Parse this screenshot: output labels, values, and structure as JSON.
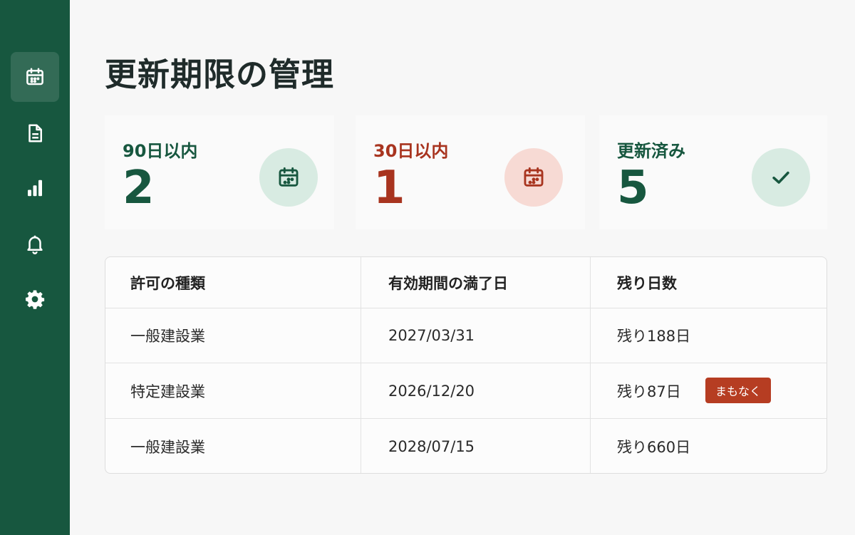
{
  "nav": {
    "items": [
      {
        "icon": "calendar-icon",
        "active": true
      },
      {
        "icon": "document-icon",
        "active": false
      },
      {
        "icon": "bar-chart-icon",
        "active": false
      },
      {
        "icon": "bell-icon",
        "active": false
      },
      {
        "icon": "gear-icon",
        "active": false
      }
    ]
  },
  "page": {
    "title": "更新期限の管理"
  },
  "stats": [
    {
      "label": "90日以内",
      "value": "2",
      "icon": "calendar-icon",
      "color": "#17573f"
    },
    {
      "label": "30日以内",
      "value": "1",
      "icon": "calendar-icon",
      "color": "#a8341f"
    },
    {
      "label": "更新済み",
      "value": "5",
      "icon": "check-icon",
      "color": "#17573f"
    }
  ],
  "table": {
    "headers": [
      "許可の種類",
      "有効期間の満了日",
      "残り日数"
    ],
    "rows": [
      {
        "type": "一般建設業",
        "date": "2027/03/31",
        "remaining": "残り188日",
        "badge": ""
      },
      {
        "type": "特定建設業",
        "date": "2026/12/20",
        "remaining": "残り87日",
        "badge": "まもなく"
      },
      {
        "type": "一般建設業",
        "date": "2028/07/15",
        "remaining": "残り660日",
        "badge": ""
      }
    ]
  },
  "colors": {
    "sidebar": "#17573f",
    "accent_green": "#17573f",
    "accent_red": "#a8341f",
    "badge": "#b63d22"
  }
}
